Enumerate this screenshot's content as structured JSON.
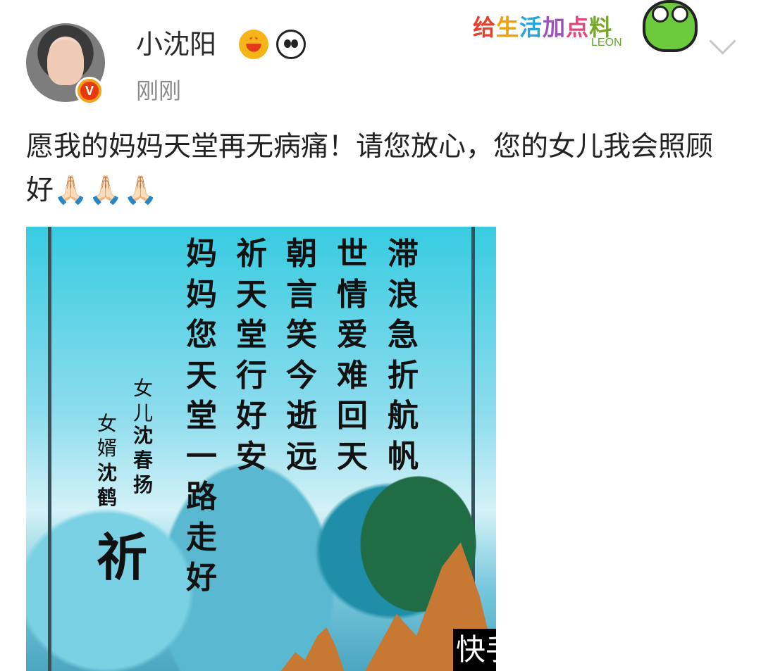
{
  "post": {
    "username": "小沈阳",
    "timestamp": "刚刚",
    "text": "愿我的妈妈天堂再无病痛！请您放心，您的女儿我会照顾好",
    "emojis": "🙏🏻🙏🏻🙏🏻",
    "verified_badge_text": "V"
  },
  "sticker": {
    "text": [
      "给",
      "生",
      "活",
      "加",
      "点",
      "料"
    ],
    "brand": "LEON"
  },
  "image": {
    "poem_columns": [
      [
        "妈",
        "妈",
        "您",
        "天",
        "堂",
        "一",
        "路",
        "走",
        "好"
      ],
      [
        "祈",
        "天",
        "堂",
        "行",
        "好",
        "安"
      ],
      [
        "朝",
        "言",
        "笑",
        "今",
        "逝",
        "远"
      ],
      [
        "世",
        "情",
        "爱",
        "难",
        "回",
        "天"
      ],
      [
        "滞",
        "浪",
        "急",
        "折",
        "航",
        "帆"
      ]
    ],
    "daughter_label": "女儿",
    "daughter_name": "沈春扬",
    "soninlaw_label": "女婿",
    "soninlaw_name": "沈鹤",
    "pray_character": "祈",
    "watermark": "快手"
  },
  "icons": [
    "crown-icon",
    "panda-icon",
    "frog-icon",
    "chevron-down-icon"
  ]
}
